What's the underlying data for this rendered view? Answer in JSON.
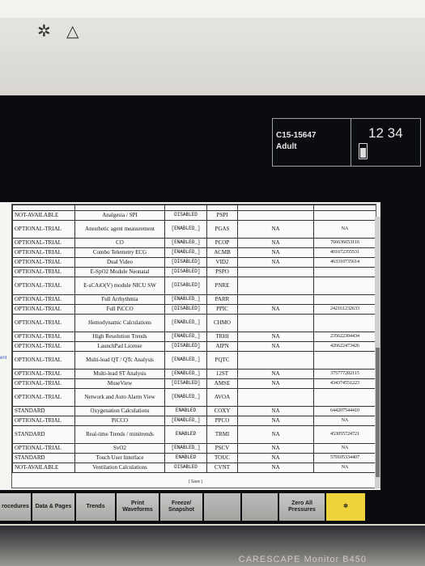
{
  "device": {
    "brand": "CARESCAPE Monitor B450",
    "top_icons": [
      "✲",
      "△"
    ]
  },
  "status": {
    "patient_id": "C15-15647",
    "patient_type": "Adult",
    "clock": "12 34"
  },
  "screen": {
    "edge_label": "ent",
    "save_label": "[ Save ]"
  },
  "options_table": {
    "rows": [
      [
        "NOT-AVAILABLE",
        "Analgesia / SPI",
        "DISABLED",
        "PSPI",
        "",
        ""
      ],
      [
        "OPTIONAL-TRIAL",
        "Anesthetic agent measurement",
        "[ENABLED_]",
        "PGAS",
        "NA",
        "NA"
      ],
      [
        "OPTIONAL-TRIAL",
        "CO",
        "[ENABLED_]",
        "PCOP",
        "NA",
        "766636653116"
      ],
      [
        "OPTIONAL-TRIAL",
        "Combo Telemetry ECG",
        "[ENABLED_]",
        "ACMB",
        "NA",
        "401672355531"
      ],
      [
        "OPTIONAL-TRIAL",
        "Dual Video",
        "[DISABLED]",
        "VID2",
        "NA",
        "463310735614"
      ],
      [
        "OPTIONAL-TRIAL",
        "E-SpO2 Module Neonatal",
        "[DISABLED]",
        "PSPO",
        "",
        ""
      ],
      [
        "OPTIONAL-TRIAL",
        "E-sCAiO(V) module NICU SW",
        "[DISABLED]",
        "PNRE",
        "",
        ""
      ],
      [
        "OPTIONAL-TRIAL",
        "Full Arrhythmia",
        "[ENABLED_]",
        "PARR",
        "",
        ""
      ],
      [
        "OPTIONAL-TRIAL",
        "Full PiCCO",
        "[DISABLED]",
        "PPIC",
        "NA",
        "242161232633"
      ],
      [
        "OPTIONAL-TRIAL",
        "Hemodynamic Calculations",
        "[ENABLED_]",
        "CHMO",
        "",
        ""
      ],
      [
        "OPTIONAL-TRIAL",
        "High Resolution Trends",
        "[ENABLED_]",
        "TRHI",
        "NA",
        "235622304434"
      ],
      [
        "OPTIONAL-TRIAL",
        "LaunchPad License",
        "[DISABLED]",
        "AIPN",
        "NA",
        "426622473426"
      ],
      [
        "OPTIONAL-TRIAL",
        "Multi-lead QT / QTc Analysis",
        "[ENABLED_]",
        "PQTC",
        "",
        ""
      ],
      [
        "OPTIONAL-TRIAL",
        "Multi-lead ST Analysis",
        "[ENABLED_]",
        "12ST",
        "NA",
        "375777202115"
      ],
      [
        "OPTIONAL-TRIAL",
        "MuseView",
        "[DISABLED]",
        "AMSE",
        "NA",
        "434374551223"
      ],
      [
        "OPTIONAL-TRIAL",
        "Network and Auto Alarm View",
        "[ENABLED_]",
        "AVOA",
        "",
        ""
      ],
      [
        "STANDARD",
        "Oxygenation Calculations",
        "ENABLED",
        "COXY",
        "NA",
        "644207544410"
      ],
      [
        "OPTIONAL-TRIAL",
        "PiCCO",
        "[ENABLED_]",
        "PPCO",
        "NA",
        "NA"
      ],
      [
        "STANDARD",
        "Real-time Trends / minitrends",
        "ENABLED",
        "TRMI",
        "NA",
        "453055724721"
      ],
      [
        "OPTIONAL-TRIAL",
        "SvO2",
        "[ENABLED_]",
        "PSCV",
        "NA",
        "NA"
      ],
      [
        "STANDARD",
        "Touch User Interface",
        "ENABLED",
        "TOUC",
        "NA",
        "579105334407"
      ],
      [
        "NOT-AVAILABLE",
        "Ventilation Calculations",
        "DISABLED",
        "CVNT",
        "NA",
        "NA"
      ]
    ]
  },
  "softkeys": [
    "rocedures",
    "Data & Pages",
    "Trends",
    "Print Waveforms",
    "Freeze/ Snapshot",
    "",
    "",
    "Zero All Pressures"
  ]
}
